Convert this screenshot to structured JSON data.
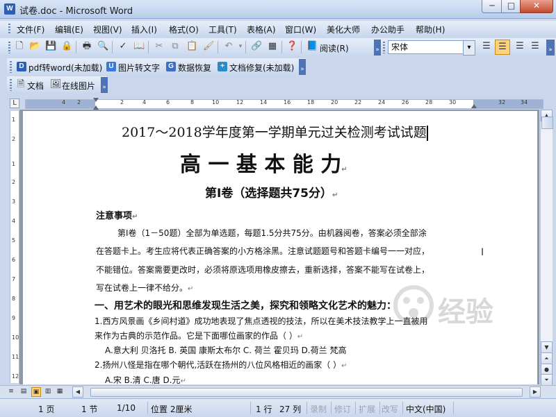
{
  "window": {
    "app_icon": "W",
    "title": "试卷.doc - Microsoft Word",
    "controls": {
      "minimize": "─",
      "maximize": "□",
      "close": "✕"
    }
  },
  "menu": [
    "文件(F)",
    "编辑(E)",
    "视图(V)",
    "插入(I)",
    "格式(O)",
    "工具(T)",
    "表格(A)",
    "窗口(W)",
    "美化大师",
    "办公助手",
    "帮助(H)"
  ],
  "toolbar": {
    "read_button": "阅读(R)",
    "font_name": "宋体",
    "font_dropdown": "▾"
  },
  "addins": {
    "pdf_to_word": "pdf转word(未加载)",
    "image_to_text": "图片转文字",
    "data_recovery": "数据恢复",
    "doc_repair": "文档修复(未加载)",
    "document": "文档",
    "online_images": "在线图片"
  },
  "ruler": {
    "corner": "L",
    "numbers": [
      "4",
      "2",
      "2",
      "4",
      "6",
      "8",
      "10",
      "12",
      "14",
      "16",
      "18",
      "20",
      "22",
      "24",
      "26",
      "28",
      "30",
      "32",
      "34"
    ],
    "vertical_numbers": [
      "1",
      "2",
      "1",
      "2",
      "3",
      "4",
      "5",
      "6",
      "7",
      "8",
      "9",
      "10",
      "11",
      "12"
    ]
  },
  "document": {
    "title": "2017～2018学年度第一学期单元过关检测考试试题",
    "subject": "高 一 基 本 能 力",
    "part": "第Ⅰ卷（选择题共75分）",
    "notice_heading": "注意事项",
    "notice_lines": [
      "第Ⅰ卷（1－50题）全部为单选题，每题1.5分共75分。由机器阅卷，答案必须全部涂",
      "在答题卡上。考生应将代表正确答案的小方格涂黑。注意试题题号和答题卡编号一一对应，",
      "不能错位。答案需要更改时，必须将原选项用橡皮擦去，重新选择，答案不能写在试卷上，",
      "写在试卷上一律不给分。"
    ],
    "section1": "一、用艺术的眼光和思维发现生活之美，探究和领略文化艺术的魅力：",
    "q1_lines": [
      "1.西方风景画《乡间村道》成功地表现了焦点透视的技法，所以在美术技法教学上一直被用",
      "来作为古典的示范作品。它是下面哪位画家的作品（      ）"
    ],
    "q1_options": "A.意大利  贝洛托     B. 英国   康斯太布尔     C. 荷兰  霍贝玛     D.荷兰   梵高",
    "q2_line": "2.扬州八怪是指在哪个朝代,活跃在扬州的八位风格相近的画家（      ）",
    "q2_options": "A.宋          B.清          C.唐          D.元",
    "para_mark": "↵"
  },
  "status": {
    "page": "1 页",
    "section": "1 节",
    "page_of": "1/10",
    "position": "位置 2厘米",
    "line": "1 行",
    "column": "27 列",
    "record": "录制",
    "revise": "修订",
    "extend": "扩展",
    "overwrite": "改写",
    "language": "中文(中国)"
  },
  "view_buttons": [
    "≡",
    "▤",
    "▣",
    "▥",
    "▦"
  ],
  "watermark_text": "经验",
  "colors": {
    "accent": "#4f74b5",
    "toolbar": "#c8d7ee",
    "page": "#ffffff",
    "close": "#c44a2c"
  }
}
